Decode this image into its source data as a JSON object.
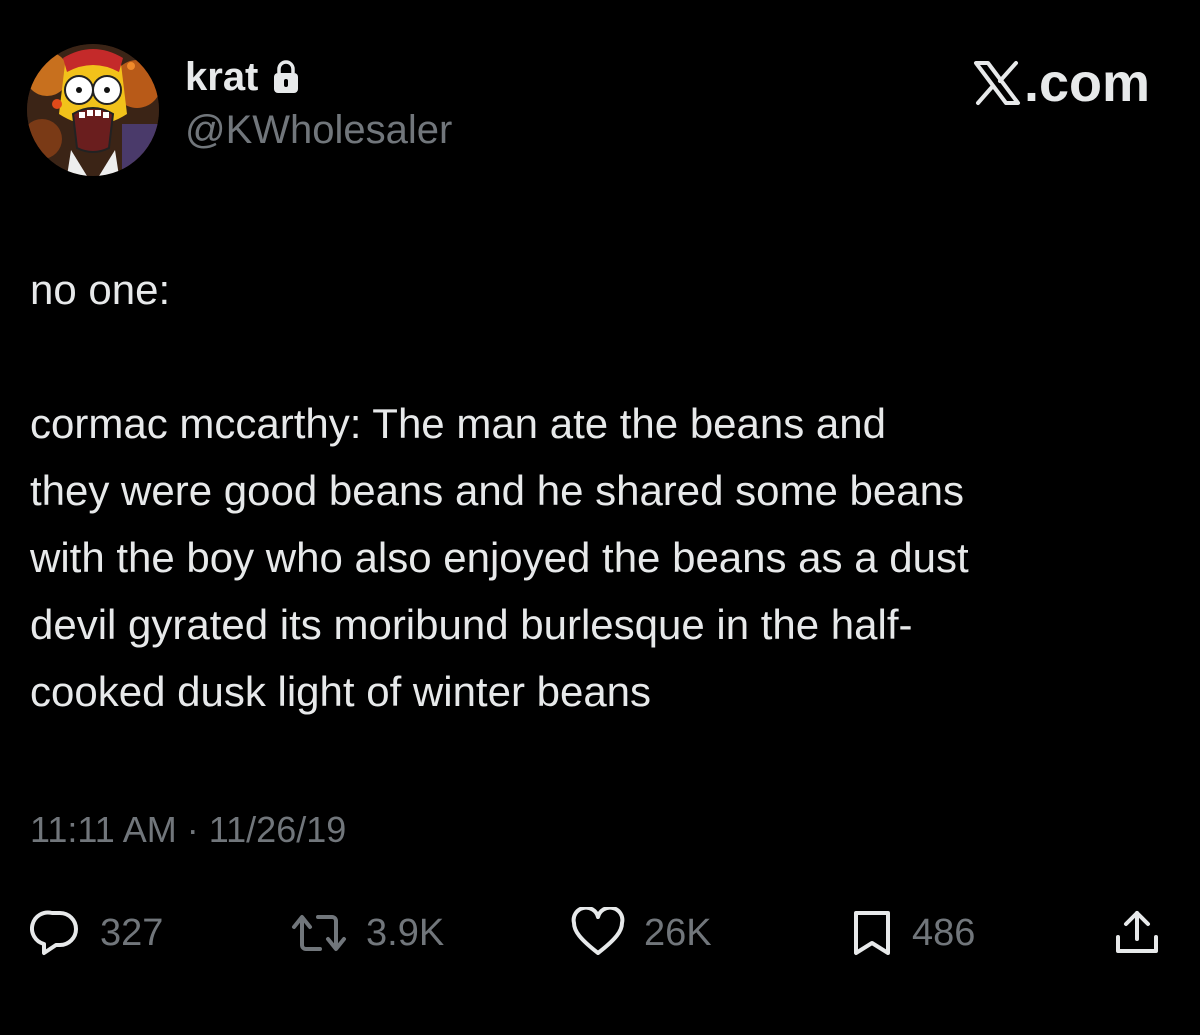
{
  "author": {
    "display_name": "krat",
    "handle": "@KWholesaler",
    "protected": true
  },
  "brand": "X.com",
  "tweet": {
    "lines_block1": [
      "no one:"
    ],
    "lines_block2": [
      "cormac mccarthy: The man ate the beans and",
      "they were good beans and he shared some beans",
      "with the boy who also enjoyed the beans as a dust",
      "devil gyrated its moribund burlesque in the half-",
      "cooked dusk light of winter beans"
    ]
  },
  "meta": {
    "time": "11:11 AM",
    "separator": "·",
    "date": "11/26/19"
  },
  "actions": {
    "reply_count": "327",
    "repost_count": "3.9K",
    "like_count": "26K",
    "bookmark_count": "486"
  },
  "colors": {
    "background": "#000000",
    "primary_text": "#e7e9ea",
    "secondary_text": "#71767b"
  },
  "icons": {
    "lock": "lock-icon",
    "reply": "reply-icon",
    "repost": "repost-icon",
    "like": "heart-icon",
    "bookmark": "bookmark-icon",
    "share": "share-icon"
  }
}
